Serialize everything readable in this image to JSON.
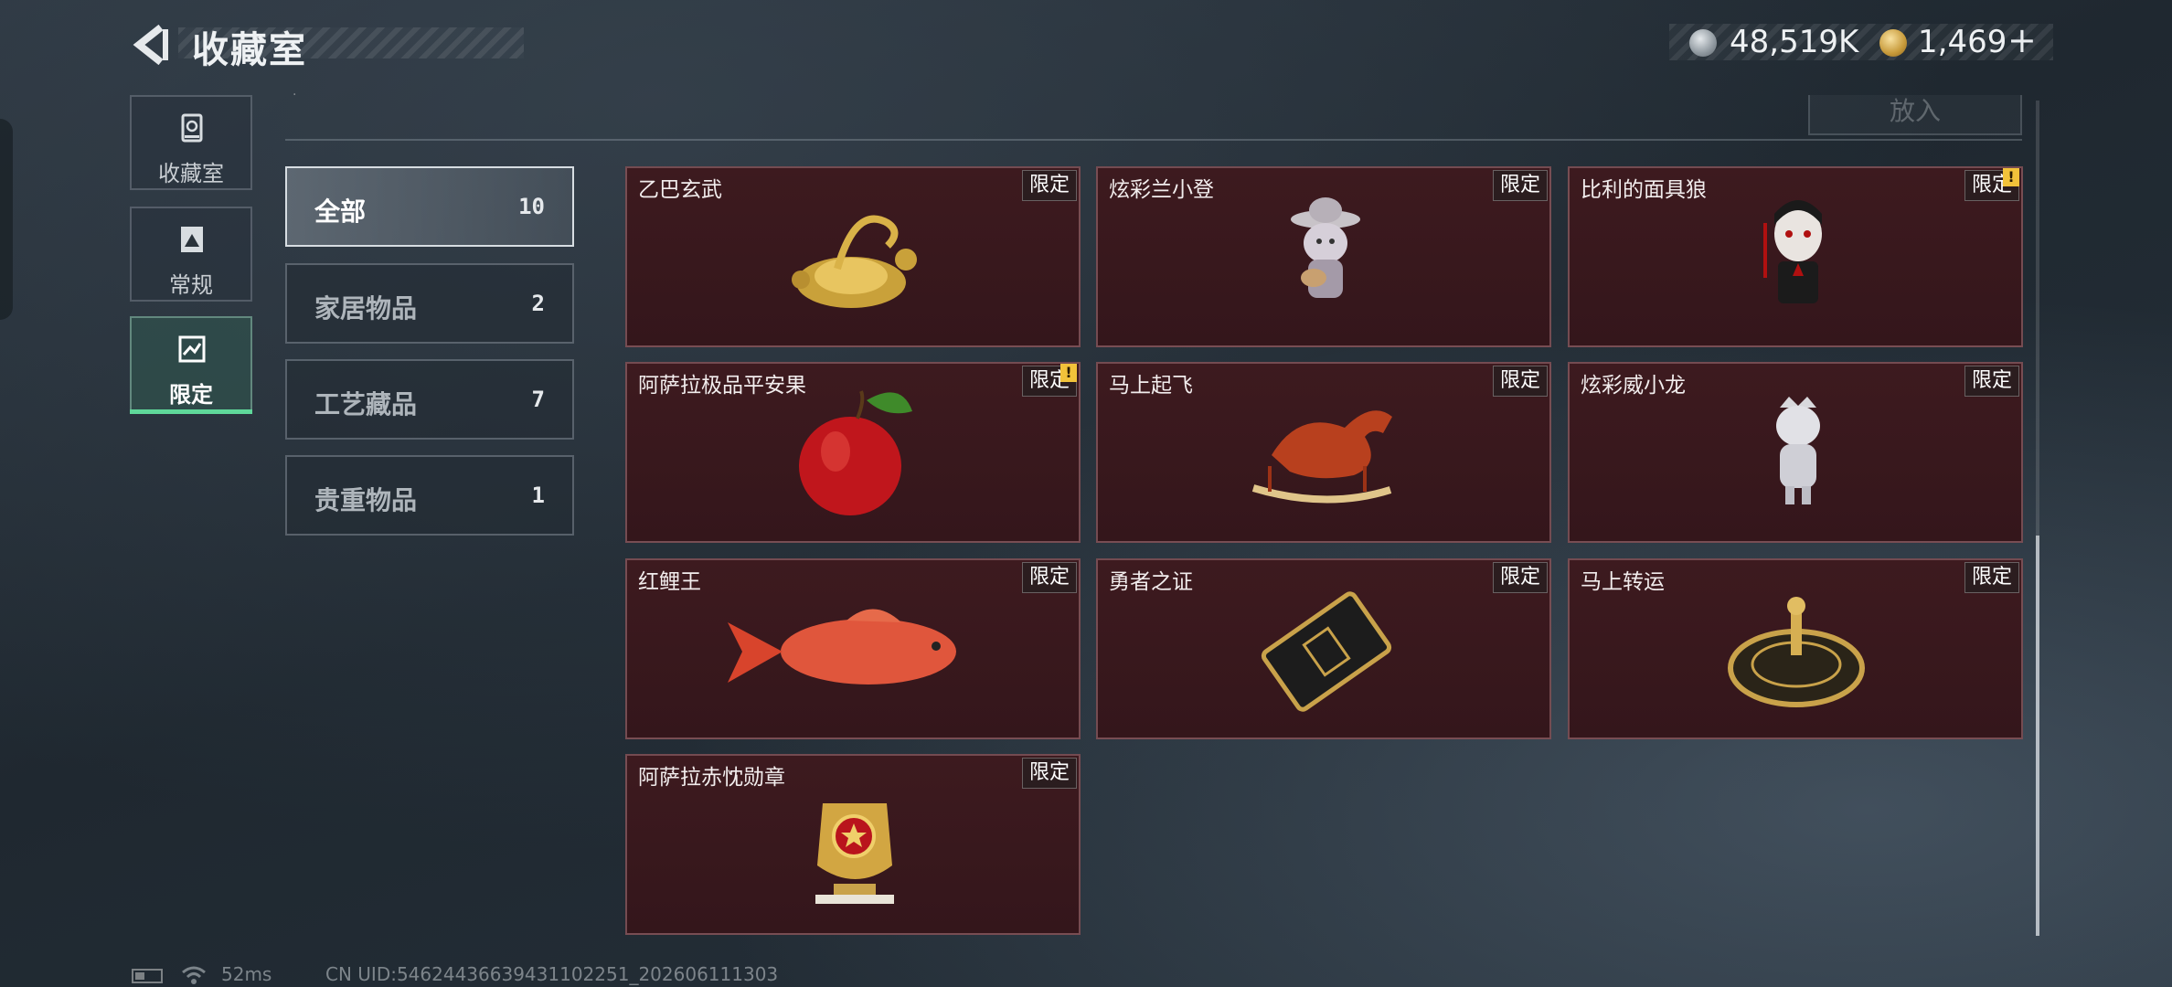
{
  "header": {
    "title": "收藏室",
    "silver_currency": "48,519K",
    "gold_currency": "1,469",
    "plus_label": "+"
  },
  "nav": {
    "items": [
      {
        "label": "收藏室",
        "icon": "collection-icon"
      },
      {
        "label": "常规",
        "icon": "regular-icon"
      },
      {
        "label": "限定",
        "icon": "limited-icon",
        "selected": true
      }
    ]
  },
  "top_cut_text": "·",
  "put_in_button": "放入",
  "categories": [
    {
      "label": "全部",
      "count": "10",
      "selected": true
    },
    {
      "label": "家居物品",
      "count": "2"
    },
    {
      "label": "工艺藏品",
      "count": "7"
    },
    {
      "label": "贵重物品",
      "count": "1"
    }
  ],
  "items": [
    {
      "name": "乙巴玄武",
      "tag": "限定",
      "alert": false,
      "icon": "golden-turtle-snake-icon"
    },
    {
      "name": "炫彩兰小登",
      "tag": "限定",
      "alert": false,
      "icon": "sombrero-figure-icon"
    },
    {
      "name": "比利的面具狼",
      "tag": "限定",
      "alert": true,
      "icon": "jigsaw-puppet-icon"
    },
    {
      "name": "阿萨拉极品平安果",
      "tag": "限定",
      "alert": true,
      "icon": "red-apple-icon"
    },
    {
      "name": "马上起飞",
      "tag": "限定",
      "alert": false,
      "icon": "red-horse-icon"
    },
    {
      "name": "炫彩威小龙",
      "tag": "限定",
      "alert": false,
      "icon": "silver-figure-icon"
    },
    {
      "name": "红鲤王",
      "tag": "限定",
      "alert": false,
      "icon": "red-carp-icon"
    },
    {
      "name": "勇者之证",
      "tag": "限定",
      "alert": false,
      "icon": "black-card-icon"
    },
    {
      "name": "马上转运",
      "tag": "限定",
      "alert": false,
      "icon": "golden-compass-icon"
    },
    {
      "name": "阿萨拉赤忱勋章",
      "tag": "限定",
      "alert": false,
      "icon": "gold-medal-icon"
    }
  ],
  "alert_symbol": "!",
  "footer": {
    "ping": "52ms",
    "uid": "CN UID:54624436639431102251_202606111303"
  },
  "colors": {
    "card_bg": "#3d1a1f",
    "accent_green": "#5fd89a",
    "alert_yellow": "#f2c23a"
  }
}
